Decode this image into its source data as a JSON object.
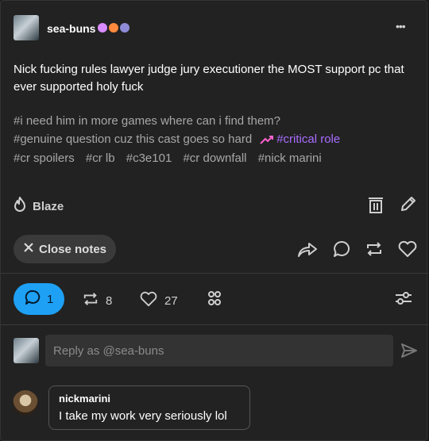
{
  "post": {
    "username": "sea-buns",
    "body": "Nick fucking rules lawyer judge jury executioner the MOST support pc that ever supported holy fuck",
    "tags_line1": "#i need him in more games where can i find them?",
    "tags_line2_a": "#genuine question cuz this cast goes so hard",
    "tags_line2_trending": "#critical role",
    "tags_line3": [
      "#cr spoilers",
      "#cr lb",
      "#c3e101",
      "#cr downfall",
      "#nick marini"
    ],
    "blaze_label": "Blaze",
    "close_notes_label": "Close notes",
    "more_label": "•••"
  },
  "notes": {
    "replies_count": "1",
    "reblogs_count": "8",
    "likes_count": "27"
  },
  "reply": {
    "placeholder": "Reply as @sea-buns"
  },
  "comment": {
    "author": "nickmarini",
    "text": "I take my work very seriously lol"
  },
  "colors": {
    "accent_blue": "#1ea0f5",
    "trending_pink": "#ff62ce",
    "tag_purple": "#a86cff"
  }
}
